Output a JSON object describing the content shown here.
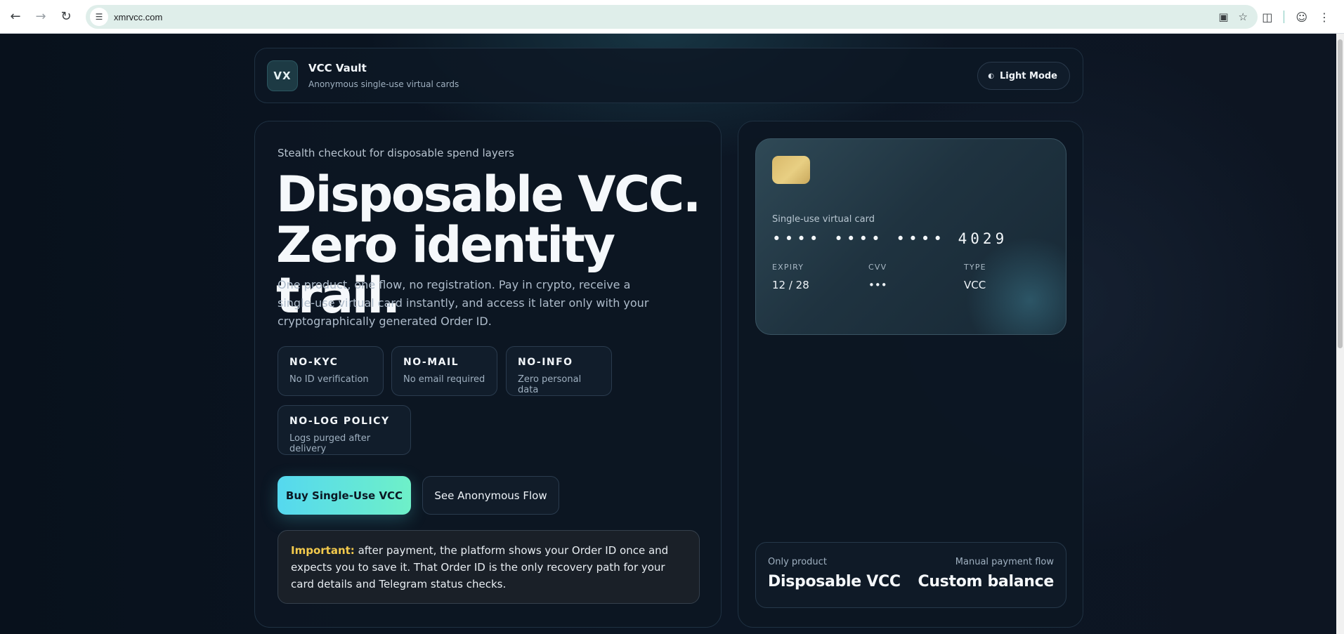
{
  "browser": {
    "url": "xmrvcc.com"
  },
  "header": {
    "logo": "VX",
    "title": "VCC Vault",
    "subtitle": "Anonymous single-use virtual cards",
    "theme_toggle": "Light Mode"
  },
  "hero": {
    "eyebrow": "Stealth checkout for disposable spend layers",
    "headline_line1": "Disposable VCC.",
    "headline_line2": "Zero identity trail.",
    "lead": "One product, one flow, no registration. Pay in crypto, receive a single-use virtual card instantly, and access it later only with your cryptographically generated Order ID.",
    "features": [
      {
        "title": "NO-KYC",
        "desc": "No ID verification"
      },
      {
        "title": "NO-MAIL",
        "desc": "No email required"
      },
      {
        "title": "NO-INFO",
        "desc": "Zero personal data"
      },
      {
        "title": "NO-LOG POLICY",
        "desc": "Logs purged after delivery"
      }
    ],
    "primary_cta": "Buy Single-Use VCC",
    "secondary_cta": "See Anonymous Flow",
    "notice_label": "Important:",
    "notice_text": " after payment, the platform shows your Order ID once and expects you to save it. That Order ID is the only recovery path for your card details and Telegram status checks."
  },
  "card": {
    "label": "Single-use virtual card",
    "number": "•••• •••• •••• 4029",
    "expiry_label": "EXPIRY",
    "expiry": "12 / 28",
    "cvv_label": "CVV",
    "cvv": "•••",
    "type_label": "TYPE",
    "type": "VCC"
  },
  "summary": {
    "left_label": "Only product",
    "left_value": "Disposable VCC",
    "right_label": "Manual payment flow",
    "right_value": "Custom balance"
  }
}
